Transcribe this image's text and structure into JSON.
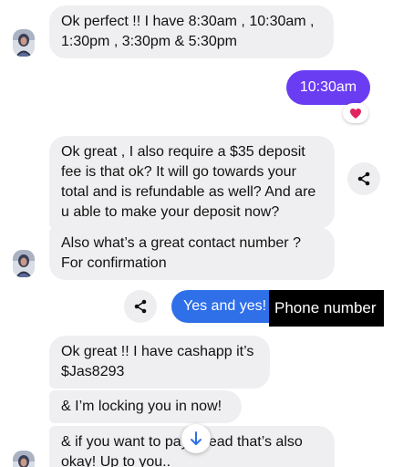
{
  "messages": {
    "m1": "Ok perfect !! I have 8:30am , 10:30am , 1:30pm , 3:30pm & 5:30pm",
    "m2": "10:30am",
    "m3": "Ok great , I also require a $35 deposit fee is that ok? It will go towards your total and is refundable as well? And are u able to make your deposit now?",
    "m4": "Also what’s a great contact number ? For confirmation",
    "m5": "Yes and yes!",
    "m6": "Ok great !! I have cashapp it’s $Jas8293",
    "m7": "& I’m locking you in now!",
    "m8": "& if you want to pay ahead that’s also okay! Up to you.."
  },
  "overlay": {
    "label": "Phone number"
  },
  "colors": {
    "incoming_bubble": "#efeff1",
    "outgoing_purple": "#6a3df2",
    "outgoing_blue": "#2f6fe8",
    "heart": "#e0245e",
    "scroll_arrow": "#2f6fe8"
  },
  "icons": {
    "share": "share-icon",
    "heart": "heart-icon",
    "scroll": "arrow-down-icon"
  }
}
